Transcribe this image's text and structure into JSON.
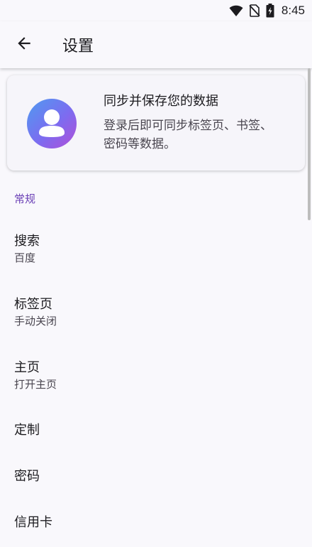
{
  "status_bar": {
    "time": "8:45",
    "icons": [
      "wifi-icon",
      "no-sim-icon",
      "battery-charging-icon"
    ]
  },
  "app_bar": {
    "title": "设置",
    "back_icon": "arrow-back-icon"
  },
  "sync_card": {
    "title": "同步并保存您的数据",
    "description": "登录后即可同步标签页、书签、密码等数据。",
    "avatar_icon": "account-avatar-icon",
    "colors": {
      "gradient_start": "#5b8def",
      "gradient_end": "#9b5be0"
    }
  },
  "general": {
    "header": "常规",
    "items": [
      {
        "title": "搜索",
        "subtitle": "百度"
      },
      {
        "title": "标签页",
        "subtitle": "手动关闭"
      },
      {
        "title": "主页",
        "subtitle": "打开主页"
      },
      {
        "title": "定制"
      },
      {
        "title": "密码"
      },
      {
        "title": "信用卡"
      }
    ]
  },
  "colors": {
    "accent": "#6a3fb5",
    "background": "#f9f8fc"
  }
}
